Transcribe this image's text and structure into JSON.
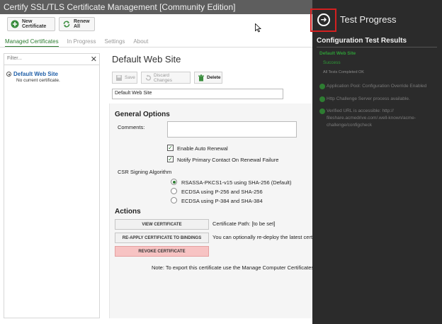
{
  "window": {
    "title": "Certify SSL/TLS Certificate Management [Community Edition]"
  },
  "toolbar": {
    "new_certificate": "New Certificate",
    "renew_all": "Renew All"
  },
  "tabs": [
    "Managed Certificates",
    "In Progress",
    "Settings",
    "About"
  ],
  "sidebar": {
    "filter_placeholder": "Filter...",
    "clear_icon": "close-icon",
    "items": [
      {
        "name": "Default Web Site",
        "status": "No current certificate."
      }
    ]
  },
  "main": {
    "title": "Default Web Site",
    "buttons": {
      "save": "Save",
      "discard": "Discard Changes",
      "delete": "Delete"
    },
    "name_value": "Default Web Site",
    "general_options": {
      "heading": "General Options",
      "comments_label": "Comments:",
      "comments_value": "",
      "enable_auto_renewal": {
        "label": "Enable Auto Renewal",
        "checked": true
      },
      "notify_contact": {
        "label": "Notify Primary Contact On Renewal Failure",
        "checked": true
      },
      "csr_label": "CSR Signing Algorithm",
      "csr_options": [
        {
          "label": "RSASSA-PKCS1-v15 using SHA-256 (Default)",
          "selected": true
        },
        {
          "label": "ECDSA using P-256 and SHA-256",
          "selected": false
        },
        {
          "label": "ECDSA using P-384 and SHA-384",
          "selected": false
        }
      ]
    },
    "actions": {
      "heading": "Actions",
      "view": "VIEW CERTIFICATE",
      "reapply": "RE-APPLY CERTIFICATE TO BINDINGS",
      "revoke": "REVOKE CERTIFICATE",
      "cert_path": "Certificate Path: [to be set]",
      "reapply_note": "You can optionally re-deploy the latest certi",
      "export_note": "Note: To export this certificate use the Manage Computer Certificates o"
    }
  },
  "test_progress": {
    "title": "Test Progress",
    "config_title": "Configuration Test Results",
    "site": "Default Web Site",
    "success": "Success",
    "all_completed": "All Tests Completed OK",
    "results": [
      "Application Pool: Configuration Override Enabled",
      "Http Challenge Server process available.",
      "Verified URL is accessible: http://",
      "fileshare.acmedrive.com/.well-known/acme-",
      "challenge/configcheck"
    ]
  },
  "colors": {
    "accent": "#2e7d32",
    "link": "#1f5fa8",
    "danger": "#f7c3c3",
    "panel": "#2b2b2b",
    "highlight": "#d32020"
  }
}
